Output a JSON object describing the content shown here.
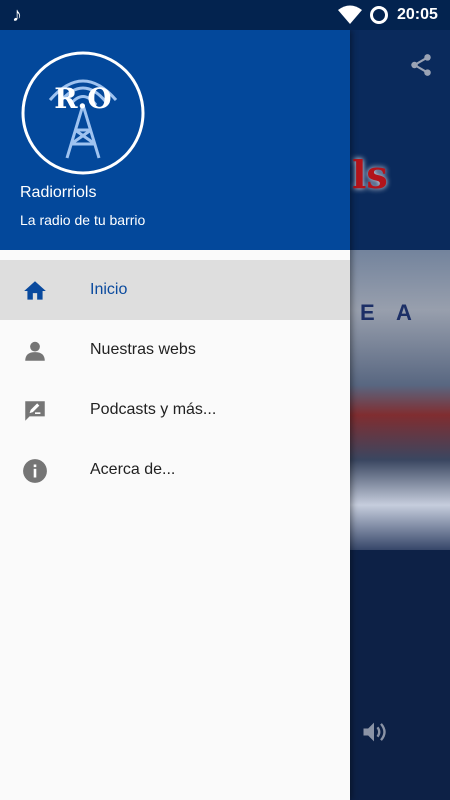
{
  "status_bar": {
    "time": "20:05"
  },
  "background": {
    "banner_text": "ls",
    "photo_text": "E A"
  },
  "drawer": {
    "logo_text": "R.O",
    "app_name": "Radiorriols",
    "app_subtitle": "La radio de tu barrio",
    "colors": {
      "header": "#03489b",
      "selected": "#0a4a9e"
    },
    "menu": [
      {
        "label": "Inicio",
        "icon": "home-icon",
        "selected": true
      },
      {
        "label": "Nuestras webs",
        "icon": "person-icon",
        "selected": false
      },
      {
        "label": "Podcasts y más...",
        "icon": "feedback-icon",
        "selected": false
      },
      {
        "label": "Acerca de...",
        "icon": "info-icon",
        "selected": false
      }
    ]
  }
}
